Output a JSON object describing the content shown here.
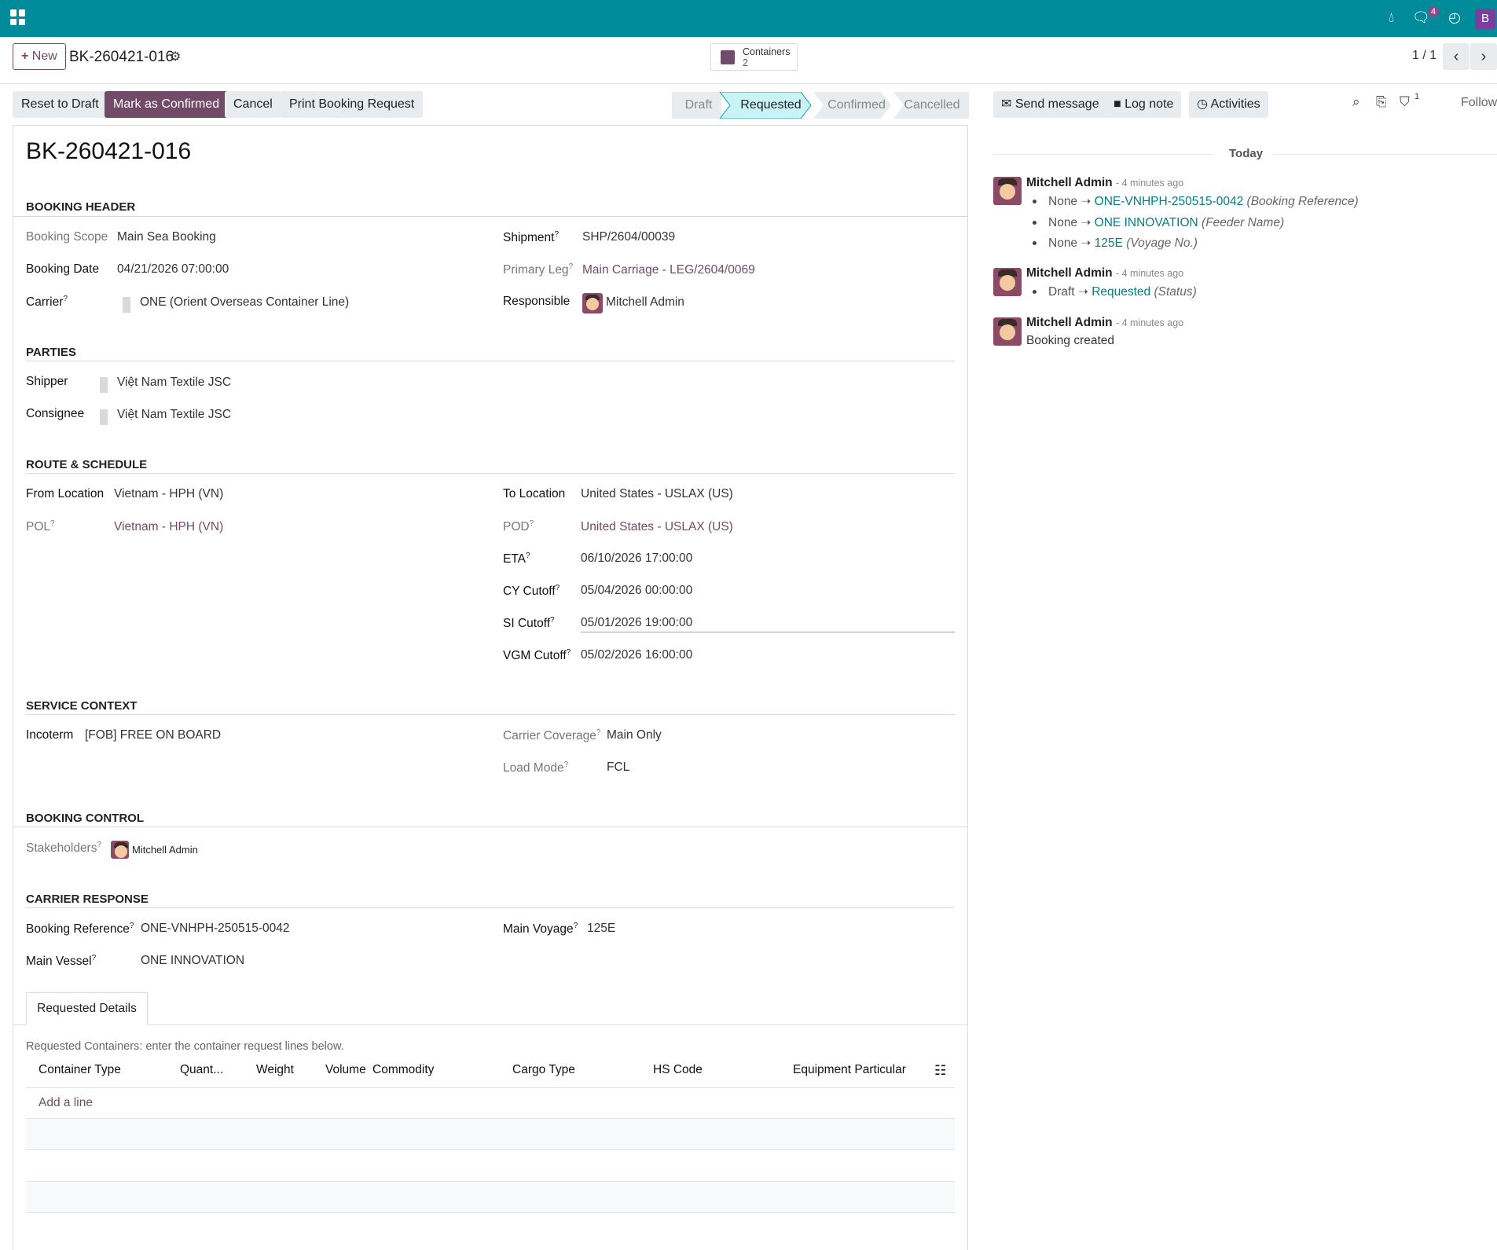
{
  "topbar": {
    "chat_badge": "4",
    "user_initial": "B"
  },
  "control": {
    "new_label": "New",
    "record_name": "BK-260421-016",
    "smart_label": "Containers",
    "smart_count": "2",
    "pager": "1 / 1"
  },
  "actions": {
    "reset": "Reset to Draft",
    "confirm": "Mark as Confirmed",
    "cancel": "Cancel",
    "print": "Print Booking Request"
  },
  "statusbar": {
    "stages": [
      "Draft",
      "Requested",
      "Confirmed",
      "Cancelled"
    ],
    "active": "Requested"
  },
  "form": {
    "title": "BK-260421-016",
    "sections": {
      "header": "BOOKING HEADER",
      "parties": "PARTIES",
      "route": "ROUTE & SCHEDULE",
      "service": "SERVICE CONTEXT",
      "control": "BOOKING CONTROL",
      "carrier": "CARRIER RESPONSE"
    },
    "labels": {
      "booking_scope": "Booking Scope",
      "booking_date": "Booking Date",
      "carrier": "Carrier",
      "shipment": "Shipment",
      "primary_leg": "Primary Leg",
      "responsible": "Responsible",
      "shipper": "Shipper",
      "consignee": "Consignee",
      "from_location": "From Location",
      "pol": "POL",
      "to_location": "To Location",
      "pod": "POD",
      "eta": "ETA",
      "cy_cutoff": "CY Cutoff",
      "si_cutoff": "SI Cutoff",
      "vgm_cutoff": "VGM Cutoff",
      "incoterm": "Incoterm",
      "carrier_coverage": "Carrier Coverage",
      "load_mode": "Load Mode",
      "stakeholders": "Stakeholders",
      "booking_reference": "Booking Reference",
      "main_vessel": "Main Vessel",
      "main_voyage": "Main Voyage"
    },
    "values": {
      "booking_scope": "Main Sea Booking",
      "booking_date": "04/21/2026 07:00:00",
      "carrier": "ONE (Orient Overseas Container Line)",
      "shipment": "SHP/2604/00039",
      "primary_leg": "Main Carriage - LEG/2604/0069",
      "responsible": "Mitchell Admin",
      "shipper": "Việt Nam Textile JSC",
      "consignee": "Việt Nam Textile JSC",
      "from_location": "Vietnam - HPH (VN)",
      "pol": "Vietnam - HPH (VN)",
      "to_location": "United States - USLAX (US)",
      "pod": "United States - USLAX (US)",
      "eta": "06/10/2026 17:00:00",
      "cy_cutoff": "05/04/2026 00:00:00",
      "si_cutoff": "05/01/2026 19:00:00",
      "vgm_cutoff": "05/02/2026 16:00:00",
      "incoterm": "[FOB] FREE ON BOARD",
      "carrier_coverage": "Main Only",
      "load_mode": "FCL",
      "stakeholder": "Mitchell Admin",
      "booking_reference": "ONE-VNHPH-250515-0042",
      "main_vessel": "ONE INNOVATION",
      "main_voyage": "125E"
    },
    "tab": "Requested Details",
    "table_hint": "Requested Containers: enter the container request lines below.",
    "columns": [
      "Container Type",
      "Quant...",
      "Weight",
      "Volume",
      "Commodity",
      "Cargo Type",
      "HS Code",
      "Equipment Particular"
    ],
    "add_line": "Add a line"
  },
  "chatter": {
    "send_message": "Send message",
    "log_note": "Log note",
    "activities": "Activities",
    "follow": "Follow",
    "followers_count": "1",
    "date_sep": "Today",
    "messages": [
      {
        "author": "Mitchell Admin",
        "time": "- 4 minutes ago",
        "changes": [
          {
            "old": "None",
            "new": "ONE-VNHPH-250515-0042",
            "field": "(Booking Reference)"
          },
          {
            "old": "None",
            "new": "ONE INNOVATION",
            "field": "(Feeder Name)"
          },
          {
            "old": "None",
            "new": "125E",
            "field": "(Voyage No.)"
          }
        ]
      },
      {
        "author": "Mitchell Admin",
        "time": "- 4 minutes ago",
        "changes": [
          {
            "old": "Draft",
            "new": "Requested",
            "field": "(Status)"
          }
        ]
      },
      {
        "author": "Mitchell Admin",
        "time": "- 4 minutes ago",
        "body": "Booking created"
      }
    ]
  }
}
